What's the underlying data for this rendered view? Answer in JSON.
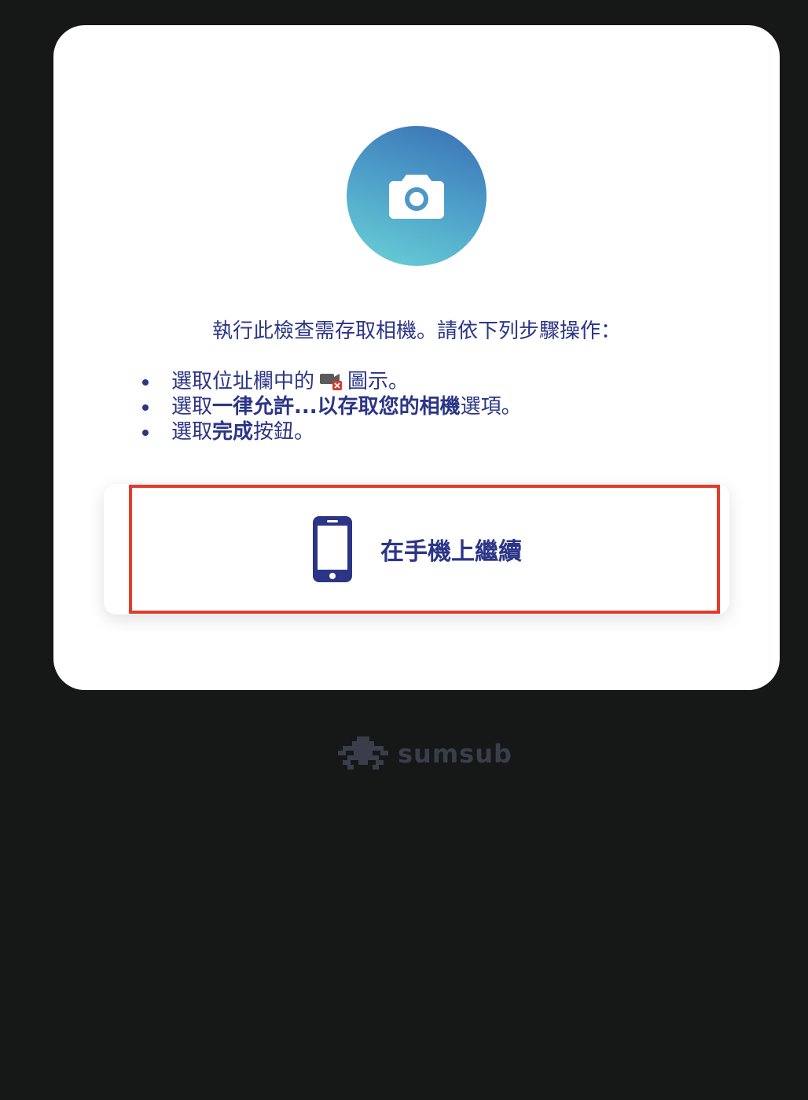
{
  "intro": "執行此檢查需存取相機。請依下列步驟操作：",
  "steps": [
    {
      "before": "選取位址欄中的",
      "icon": "camera-blocked-icon",
      "after": "圖示。"
    },
    {
      "before": "選取",
      "bold": "一律允許...以存取您的相機",
      "after": "選項。"
    },
    {
      "before": "選取",
      "bold": "完成",
      "after": "按鈕。"
    }
  ],
  "continue_button": {
    "label": "在手機上繼續",
    "icon": "smartphone-icon"
  },
  "brand": {
    "name": "sumsub",
    "logo_icon": "sumsub-logo-icon"
  },
  "colors": {
    "text": "#2c3585",
    "background": "#161717",
    "card": "#ffffff",
    "highlight": "#e33b2a"
  }
}
